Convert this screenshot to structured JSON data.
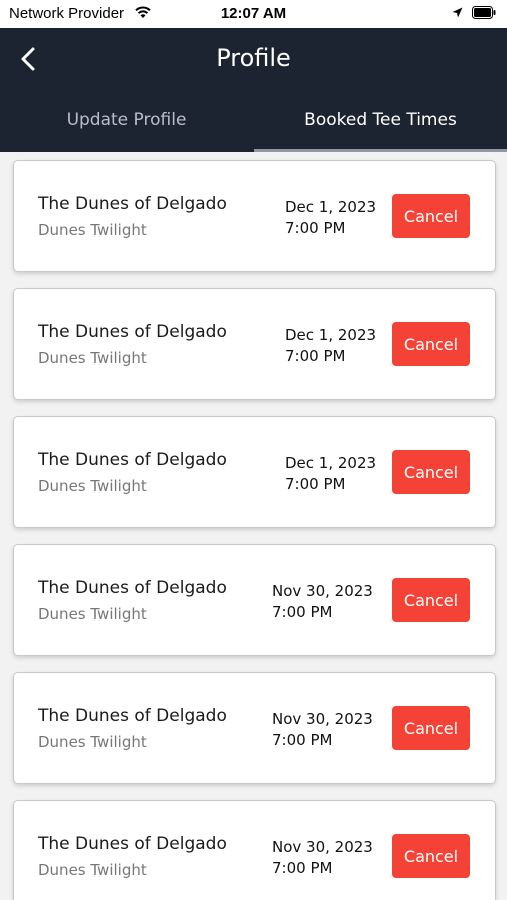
{
  "status_bar": {
    "carrier": "Network Provider",
    "time": "12:07 AM",
    "wifi_icon": "wifi-icon",
    "location_icon": "location-arrow-icon",
    "battery_icon": "battery-icon"
  },
  "header": {
    "title": "Profile",
    "back_icon": "chevron-left-icon",
    "background": "#1c2331"
  },
  "tabs": [
    {
      "label": "Update Profile",
      "selected": false
    },
    {
      "label": "Booked Tee Times",
      "selected": true
    }
  ],
  "bookings": [
    {
      "course": "The Dunes of Delgado",
      "subtitle": "Dunes Twilight",
      "date": "Dec 1, 2023",
      "time": "7:00 PM",
      "button": "Cancel"
    },
    {
      "course": "The Dunes of Delgado",
      "subtitle": "Dunes Twilight",
      "date": "Dec 1, 2023",
      "time": "7:00 PM",
      "button": "Cancel"
    },
    {
      "course": "The Dunes of Delgado",
      "subtitle": "Dunes Twilight",
      "date": "Dec 1, 2023",
      "time": "7:00 PM",
      "button": "Cancel"
    },
    {
      "course": "The Dunes of Delgado",
      "subtitle": "Dunes Twilight",
      "date": "Nov 30, 2023",
      "time": "7:00 PM",
      "button": "Cancel"
    },
    {
      "course": "The Dunes of Delgado",
      "subtitle": "Dunes Twilight",
      "date": "Nov 30, 2023",
      "time": "7:00 PM",
      "button": "Cancel"
    },
    {
      "course": "The Dunes of Delgado",
      "subtitle": "Dunes Twilight",
      "date": "Nov 30, 2023",
      "time": "7:00 PM",
      "button": "Cancel"
    }
  ],
  "colors": {
    "accent_cancel": "#f44336",
    "header_bg": "#1c2331"
  }
}
